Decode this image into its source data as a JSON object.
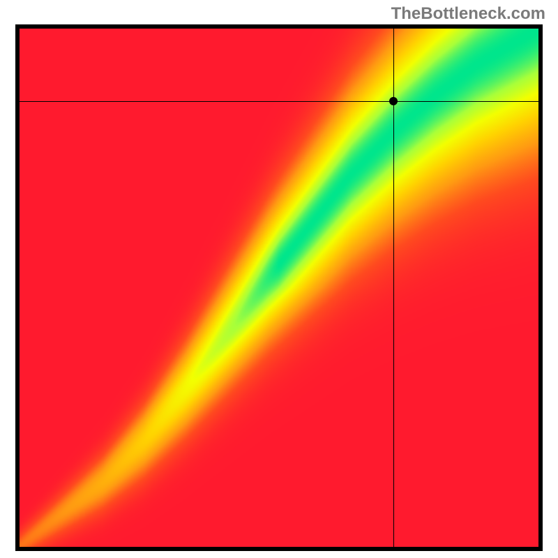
{
  "watermark": "TheBottleneck.com",
  "chart_data": {
    "type": "heatmap",
    "title": "",
    "xlabel": "",
    "ylabel": "",
    "xlim": [
      0,
      100
    ],
    "ylim": [
      0,
      100
    ],
    "colormap": {
      "stops": [
        {
          "t": 0.0,
          "color": "#ff1a2e"
        },
        {
          "t": 0.2,
          "color": "#ff4a1f"
        },
        {
          "t": 0.4,
          "color": "#ff9a12"
        },
        {
          "t": 0.6,
          "color": "#ffd400"
        },
        {
          "t": 0.75,
          "color": "#f3ff00"
        },
        {
          "t": 0.88,
          "color": "#a8ff3a"
        },
        {
          "t": 1.0,
          "color": "#00e68c"
        }
      ]
    },
    "ridge": [
      {
        "x": 0,
        "y": 0
      },
      {
        "x": 8,
        "y": 6
      },
      {
        "x": 16,
        "y": 12
      },
      {
        "x": 24,
        "y": 20
      },
      {
        "x": 32,
        "y": 30
      },
      {
        "x": 40,
        "y": 41
      },
      {
        "x": 48,
        "y": 52
      },
      {
        "x": 56,
        "y": 62
      },
      {
        "x": 64,
        "y": 72
      },
      {
        "x": 72,
        "y": 80
      },
      {
        "x": 80,
        "y": 87
      },
      {
        "x": 88,
        "y": 93
      },
      {
        "x": 100,
        "y": 100
      }
    ],
    "ridge_width": {
      "base": 2,
      "growth": 0.1
    },
    "crosshair": {
      "x": 72,
      "y": 86
    },
    "marker": {
      "x": 72,
      "y": 86
    }
  }
}
